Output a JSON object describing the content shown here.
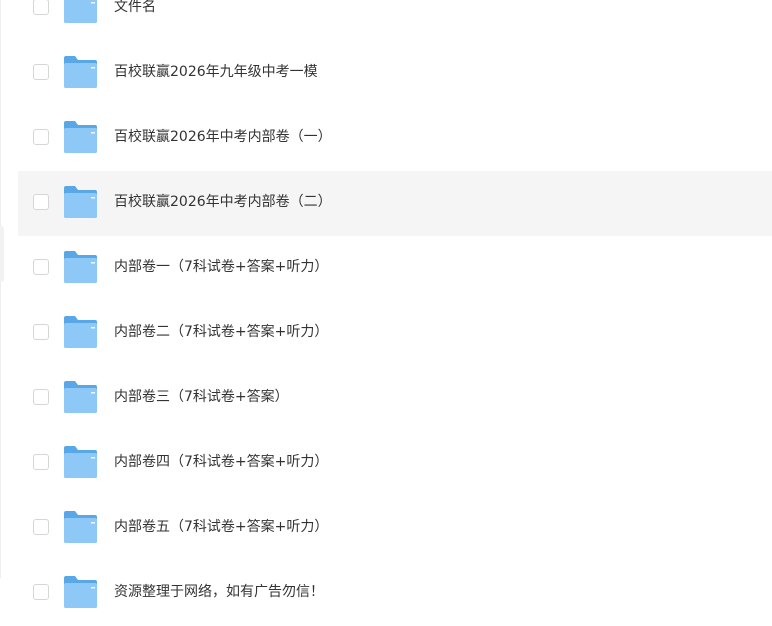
{
  "colors": {
    "folder_back": "#5aa7e8",
    "folder_front": "#8ec8f6",
    "hover_row_bg": "#f5f5f6",
    "text": "#333333",
    "checkbox_border": "#d6d6d6"
  },
  "file_list": {
    "items": [
      {
        "name": "文件名",
        "icon": "folder-icon"
      },
      {
        "name": "百校联赢2026年九年级中考一模",
        "icon": "folder-icon"
      },
      {
        "name": "百校联赢2026年中考内部卷（一）",
        "icon": "folder-icon"
      },
      {
        "name": "百校联赢2026年中考内部卷（二）",
        "icon": "folder-icon",
        "hovered": true
      },
      {
        "name": "内部卷一（7科试卷+答案+听力）",
        "icon": "folder-icon"
      },
      {
        "name": "内部卷二（7科试卷+答案+听力）",
        "icon": "folder-icon"
      },
      {
        "name": "内部卷三（7科试卷+答案）",
        "icon": "folder-icon"
      },
      {
        "name": "内部卷四（7科试卷+答案+听力）",
        "icon": "folder-icon"
      },
      {
        "name": "内部卷五（7科试卷+答案+听力）",
        "icon": "folder-icon"
      },
      {
        "name": "资源整理于网络，如有广告勿信！",
        "icon": "folder-icon"
      }
    ]
  }
}
